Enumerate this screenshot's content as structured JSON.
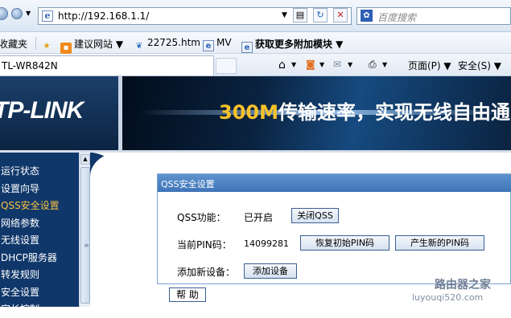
{
  "browser": {
    "url": "http://192.168.1.1/",
    "search_placeholder": "百度搜索",
    "tab_title": "TL-WR842N",
    "favorites_label": "收藏夹",
    "favorites": [
      {
        "label": "建议网站 ▼",
        "icon": "orange-site-icon"
      },
      {
        "label": "22725.htm",
        "icon": "page-icon"
      },
      {
        "label": "MV",
        "icon": "ie-page-icon"
      },
      {
        "label": "获取更多附加模块 ▼",
        "icon": "ie-page-icon"
      }
    ],
    "commands": {
      "page": "页面(P) ▼",
      "safety": "安全(S) ▼"
    }
  },
  "banner": {
    "logo": "TP-LINK",
    "slogan_highlight": "300M",
    "slogan_rest": "传输速率，实现无线自由通"
  },
  "sidebar": {
    "items": [
      {
        "label": "运行状态",
        "active": false
      },
      {
        "label": "设置向导",
        "active": false
      },
      {
        "label": "QSS安全设置",
        "active": true
      },
      {
        "label": "网络参数",
        "active": false
      },
      {
        "label": "无线设置",
        "active": false
      },
      {
        "label": "DHCP服务器",
        "active": false
      },
      {
        "label": "转发规则",
        "active": false
      },
      {
        "label": "安全设置",
        "active": false
      },
      {
        "label": "家长控制",
        "active": false
      }
    ]
  },
  "qss": {
    "title": "QSS安全设置",
    "function_label": "QSS功能：",
    "function_value": "已开启",
    "close_button": "关闭QSS",
    "pin_label": "当前PIN码：",
    "pin_value": "14099281",
    "restore_pin_button": "恢复初始PIN码",
    "new_pin_button": "产生新的PIN码",
    "add_device_label": "添加新设备：",
    "add_device_button": "添加设备",
    "help_button": "帮 助"
  },
  "watermark": {
    "line1": "路由器之家",
    "line2": "luyouqi520.com"
  },
  "colors": {
    "sidebar_bg": "#10376a",
    "active_item": "#f6c23e",
    "panel_header": "#4f85c5",
    "slogan_highlight": "#f8c22a"
  }
}
